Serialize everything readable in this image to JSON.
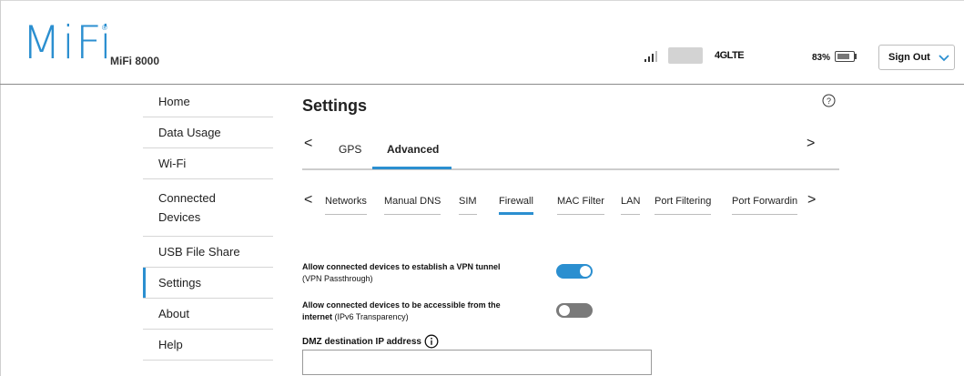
{
  "header": {
    "logo": "MiFi",
    "logo_mark": "®",
    "model": "MiFi 8000",
    "signal_icon": "signal-bars-icon",
    "network_type": "4GLTE",
    "battery_percent": "83%",
    "battery_level": 0.83,
    "sign_out_label": "Sign Out"
  },
  "sidebar": {
    "items": [
      {
        "label": "Home"
      },
      {
        "label": "Data Usage"
      },
      {
        "label": "Wi-Fi"
      },
      {
        "label": "Connected Devices"
      },
      {
        "label": "USB File Share"
      },
      {
        "label": "Settings",
        "active": true
      },
      {
        "label": "About"
      },
      {
        "label": "Help"
      }
    ]
  },
  "main": {
    "title": "Settings",
    "tabs": [
      {
        "label": "GPS"
      },
      {
        "label": "Advanced",
        "active": true
      }
    ],
    "subtabs": [
      {
        "label": "Networks"
      },
      {
        "label": "Manual DNS"
      },
      {
        "label": "SIM"
      },
      {
        "label": "Firewall",
        "active": true
      },
      {
        "label": "MAC Filter"
      },
      {
        "label": "LAN"
      },
      {
        "label": "Port Filtering"
      },
      {
        "label": "Port Forwardin"
      }
    ],
    "settings": [
      {
        "label_bold": "Allow connected devices to establish a VPN tunnel",
        "label_sub": "(VPN Passthrough)",
        "enabled": true
      },
      {
        "label_bold_1": "Allow connected devices to be accessible from the",
        "label_bold_2": "internet",
        "label_sub": "(IPv6 Transparency)",
        "enabled": false
      }
    ],
    "dmz": {
      "label": "DMZ destination IP address",
      "value": ""
    }
  },
  "colors": {
    "accent": "#2b8fd0",
    "toggle_off": "#7a7a7a"
  }
}
